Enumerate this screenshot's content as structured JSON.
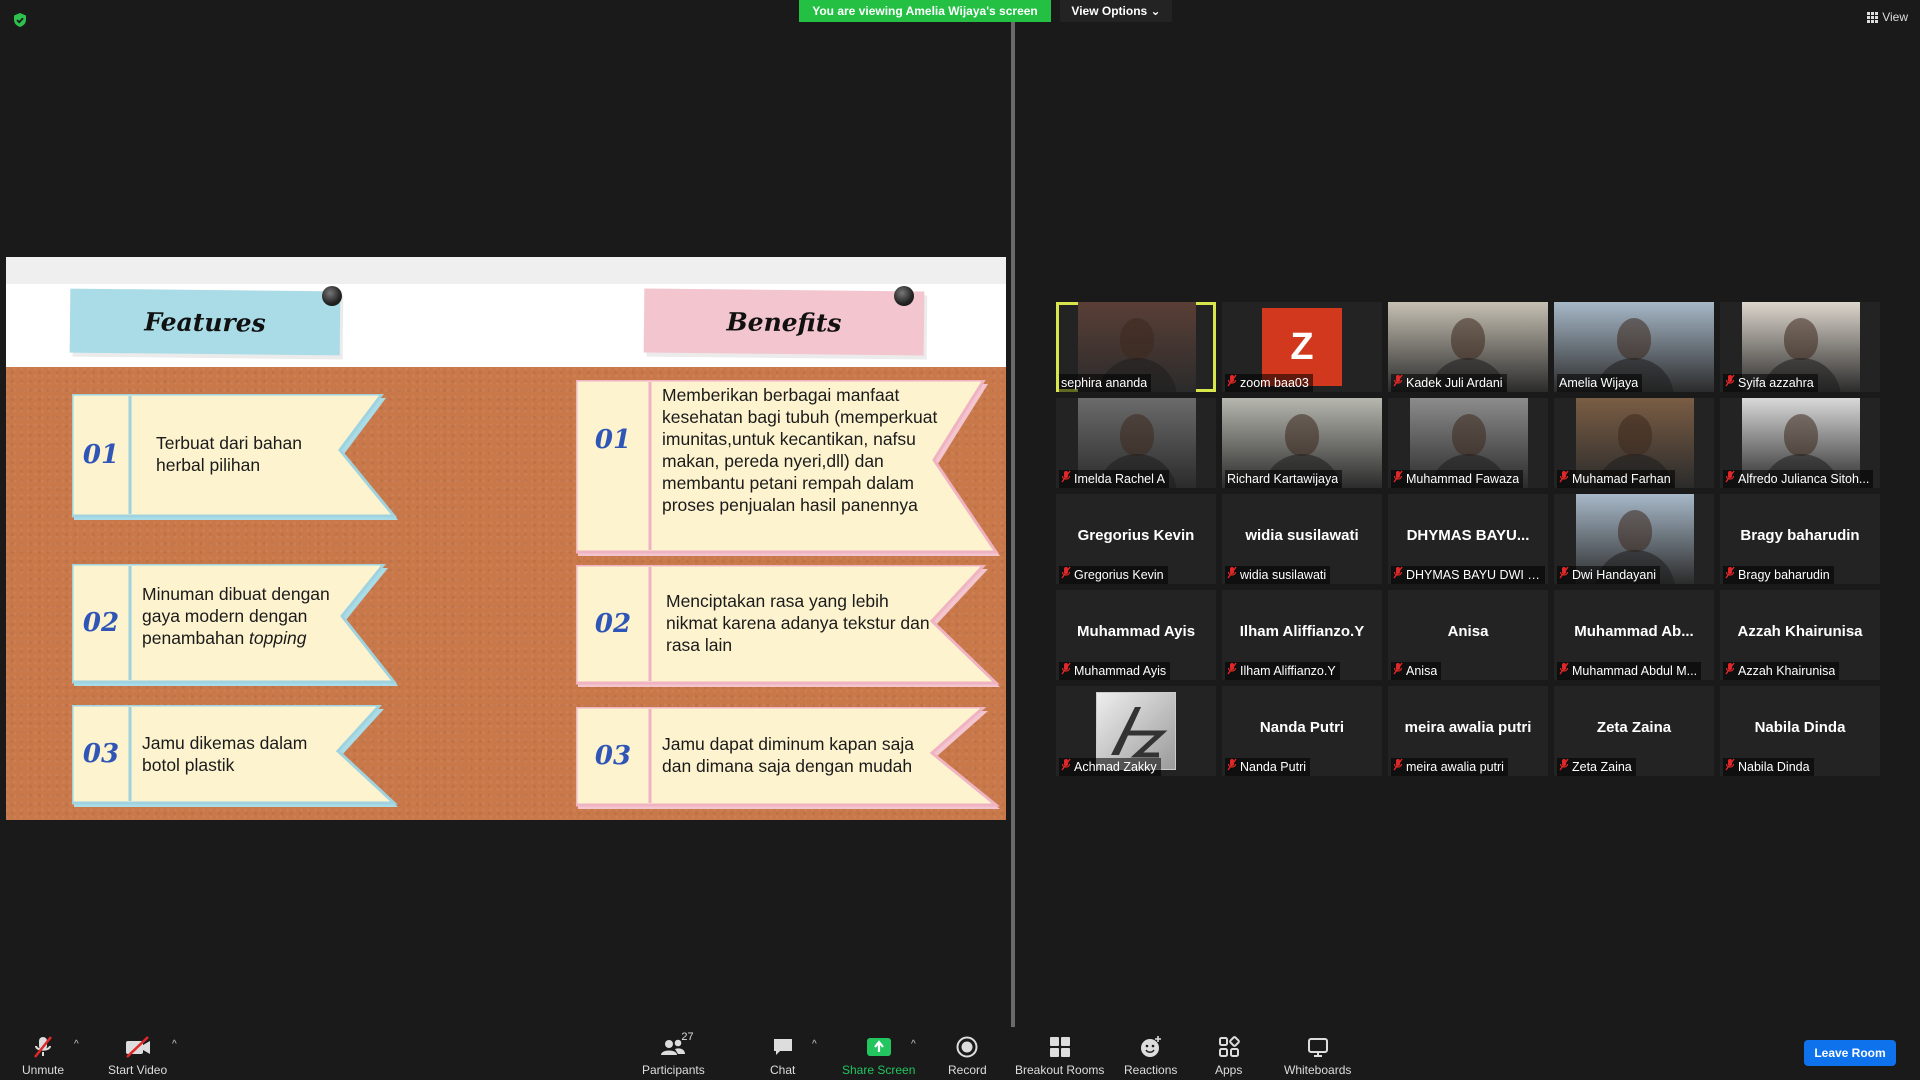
{
  "banner": {
    "viewing": "You are viewing Amelia Wijaya's screen",
    "view_options": "View Options ⌄",
    "view": "View"
  },
  "slide": {
    "features_title": "Features",
    "benefits_title": "Benefits",
    "features": [
      {
        "num": "01",
        "text": "Terbuat dari bahan herbal pilihan"
      },
      {
        "num": "02",
        "text_main": "Minuman dibuat dengan gaya modern dengan penambahan",
        "text_italic": "topping"
      },
      {
        "num": "03",
        "text": "Jamu dikemas dalam botol plastik"
      }
    ],
    "benefits": [
      {
        "num": "01",
        "text": "Memberikan berbagai manfaat kesehatan bagi tubuh (memperkuat imunitas,untuk kecantikan, nafsu makan, pereda nyeri,dll)  dan membantu petani rempah dalam proses penjualan hasil panennya"
      },
      {
        "num": "02",
        "text": "Menciptakan rasa yang lebih nikmat karena adanya tekstur dan rasa lain"
      },
      {
        "num": "03",
        "text": "Jamu dapat diminum kapan saja dan dimana saja dengan mudah"
      }
    ]
  },
  "participants": [
    {
      "name": "sephira ananda",
      "video": true,
      "muted": false,
      "active": true
    },
    {
      "name": "zoom baa03",
      "avatar": "Z",
      "muted": true
    },
    {
      "name": "Kadek Juli Ardani",
      "video": true,
      "muted": true
    },
    {
      "name": "Amelia Wijaya",
      "video": true,
      "muted": false
    },
    {
      "name": "Syifa azzahra",
      "video": true,
      "muted": true
    },
    {
      "name": "Imelda Rachel A",
      "video": true,
      "muted": true
    },
    {
      "name": "Richard Kartawijaya",
      "video": true,
      "muted": false
    },
    {
      "name": "Muhammad Fawaza",
      "video": true,
      "muted": true
    },
    {
      "name": "Muhamad Farhan",
      "video": true,
      "muted": true
    },
    {
      "name": "Alfredo Julianса Sitoh...",
      "video": true,
      "muted": true
    },
    {
      "name": "Gregorius Kevin",
      "display": "Gregorius Kevin",
      "muted": true
    },
    {
      "name": "widia susilawati",
      "display": "widia susilawati",
      "muted": true
    },
    {
      "name": "DHYMAS BAYU DWI S...",
      "display": "DHYMAS BAYU...",
      "muted": true
    },
    {
      "name": "Dwi Handayani",
      "video": true,
      "muted": true
    },
    {
      "name": "Bragy baharudin",
      "display": "Bragy baharudin",
      "muted": true
    },
    {
      "name": "Muhammad Ayis",
      "display": "Muhammad Ayis",
      "muted": true
    },
    {
      "name": "Ilham Aliffianzo.Y",
      "display": "Ilham Aliffianzo.Y",
      "muted": true
    },
    {
      "name": "Anisa",
      "display": "Anisa",
      "muted": true
    },
    {
      "name": "Muhammad Abdul M...",
      "display": "Muhammad Ab...",
      "muted": true
    },
    {
      "name": "Azzah Khairunisa",
      "display": "Azzah Khairunisa",
      "muted": true
    },
    {
      "name": "Achmad Zakky",
      "logo": true,
      "muted": true
    },
    {
      "name": "Nanda Putri",
      "display": "Nanda Putri",
      "muted": true
    },
    {
      "name": "meira awalia putri",
      "display": "meira awalia putri",
      "muted": true
    },
    {
      "name": "Zeta Zaina",
      "display": "Zeta Zaina",
      "muted": true
    },
    {
      "name": "Nabila Dinda",
      "display": "Nabila Dinda",
      "muted": true
    }
  ],
  "toolbar": {
    "unmute": "Unmute",
    "start_video": "Start Video",
    "participants": "Participants",
    "participants_count": "27",
    "chat": "Chat",
    "share_screen": "Share Screen",
    "record": "Record",
    "breakout_rooms": "Breakout Rooms",
    "reactions": "Reactions",
    "apps": "Apps",
    "whiteboards": "Whiteboards",
    "leave_room": "Leave Room"
  },
  "colors": {
    "banner_green": "#23c044",
    "active_speaker": "#d7e64a",
    "leave": "#0e72ed",
    "share_green": "#22c55e",
    "mute_red": "#e02828"
  }
}
